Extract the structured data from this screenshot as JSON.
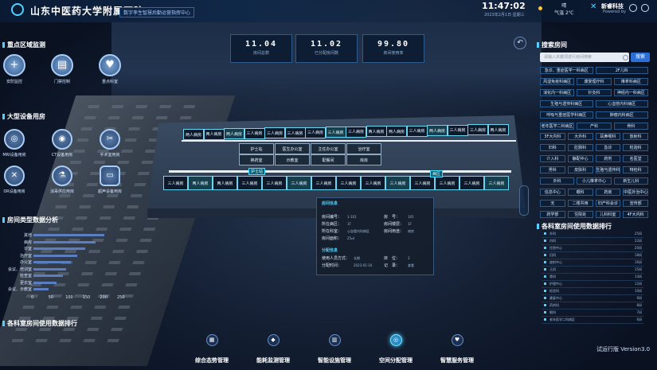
{
  "header": {
    "title": "山东中医药大学附属医院",
    "subtitle": "数字孪生智慧后勤运营指挥中心",
    "time": "11:47:02",
    "date": "2023年2月1日 星期三",
    "weather": "晴",
    "temperature": "2℃",
    "temperature_label": "气温",
    "brand": "新睿科技",
    "brand_sub": "Powered by"
  },
  "stats": [
    {
      "value": "11.04",
      "label": "房间总数"
    },
    {
      "value": "11.02",
      "label": "已分配房间数"
    },
    {
      "value": "99.80",
      "label": "房间使用率"
    }
  ],
  "left": {
    "section_key_area": "重点区域监测",
    "key_buttons": [
      {
        "label": "安防监控",
        "icon": "plus-icon"
      },
      {
        "label": "门禁控制",
        "icon": "book-icon"
      },
      {
        "label": "重点科室",
        "icon": "heart-icon"
      }
    ],
    "section_devices": "大型设备用房",
    "device_buttons": [
      {
        "label": "MRI设备用房",
        "icon": "mri-icon"
      },
      {
        "label": "CT设备用房",
        "icon": "ct-icon"
      },
      {
        "label": "手术室用房",
        "icon": "scissors-icon"
      },
      {
        "label": "DR设备用房",
        "icon": "x-icon"
      },
      {
        "label": "消毒供应用房",
        "icon": "lab-icon"
      },
      {
        "label": "超声设备用房",
        "icon": "monitor-icon"
      }
    ],
    "section_room_types": "房间类型数据分析",
    "section_usage_rank": "各科室房间使用数据排行"
  },
  "chart_data": {
    "type": "bar",
    "orientation": "horizontal",
    "categories": [
      "其他",
      "病房",
      "诊室",
      "治疗室",
      "办公室",
      "会议、培训室",
      "检查室",
      "更衣室",
      "会议、示教室"
    ],
    "values": [
      205,
      180,
      150,
      128,
      108,
      95,
      85,
      68,
      45
    ],
    "xticks": [
      "0",
      "50",
      "100",
      "150",
      "200",
      "250"
    ],
    "xlim": [
      0,
      250
    ],
    "color": "#5a7ec0"
  },
  "floorplan": {
    "rooms_row1": [
      "两人病房",
      "两人病房",
      "两人病房",
      "三人病房",
      "三人病房",
      "三人病房",
      "三人病房",
      "三人病房",
      "三人病房",
      "两人病房",
      "两人病房",
      "三人病房",
      "两人病房",
      "三人病房",
      "三人病房",
      "两人病房"
    ],
    "rooms_row2": [
      "三人病房",
      "两人病房",
      "两人病房",
      "三人病房",
      "三人病房",
      "三人病房",
      "三人病房",
      "三人病房",
      "三人病房",
      "三人病房",
      "三人病房",
      "三人病房",
      "三人病房",
      "三人病房"
    ],
    "center_rooms": [
      "护士站",
      "医生办公室",
      "主任办公室",
      "治疗室",
      "换药室",
      "示教室",
      "配餐间",
      "库房"
    ],
    "tags": [
      "护士站",
      "病区"
    ]
  },
  "popup": {
    "head1": "房间信息",
    "fields": [
      {
        "k": "房间编号：",
        "v": "1-101"
      },
      {
        "k": "所在病区：",
        "v": "1F"
      },
      {
        "k": "所在科室：",
        "v": "心血管内科病区"
      },
      {
        "k": "房间面积：",
        "v": "25㎡"
      }
    ],
    "fields_right": [
      {
        "k": "房　号：",
        "v": "101"
      },
      {
        "k": "房间楼层：",
        "v": "1F"
      },
      {
        "k": "房间用途：",
        "v": "病房"
      }
    ],
    "head2": "分配信息",
    "alloc": [
      {
        "k": "使用人员方式：",
        "v": "长期"
      },
      {
        "k": "分配时间：",
        "v": "2023-01-10"
      }
    ],
    "alloc_right": [
      {
        "k": "床　位：",
        "v": "3"
      },
      {
        "k": "记　录：",
        "v": "查看"
      }
    ]
  },
  "right": {
    "section_search": "搜索房间",
    "search_placeholder": "请输入关键词进行房间搜索",
    "search_button": "搜索",
    "chips": [
      [
        "急诊、重症医学一科病区",
        "2F儿科"
      ],
      [
        "风湿免疫科病区",
        "康复理疗科",
        "推拿科病区"
      ],
      [
        "消化内一科病区",
        "针灸科",
        "神经内一科病区"
      ],
      [
        "生殖与遗传科病区",
        "心血管内科病区"
      ],
      [
        "呼吸与重症医学科病区",
        "肿瘤内科病区"
      ],
      [
        "老年医学二科病区",
        "产科",
        "骨科"
      ],
      [
        "3F大内科",
        "大外科",
        "耳鼻喉科",
        "放射科"
      ],
      [
        "妇科",
        "肛肠科",
        "急诊",
        "检验科"
      ],
      [
        "介入科",
        "静配中心",
        "药剂",
        "名医堂"
      ],
      [
        "男科",
        "皮肤科",
        "生殖与遗传科",
        "特检科"
      ],
      [
        "外科",
        "小儿推拿中心",
        "新生儿科"
      ],
      [
        "信息中心",
        "眼科",
        "药房",
        "中医外治中心"
      ],
      [
        "无",
        "二楼共用",
        "妇产科会诊",
        "宣传部"
      ],
      [
        "药学部",
        "住院处",
        "儿科科室",
        "4F大内科"
      ]
    ],
    "section_usage": "各科室房间使用数据排行",
    "usage_rows": [
      {
        "name": "外科",
        "val": "25间"
      },
      {
        "name": "内科",
        "val": "22间"
      },
      {
        "name": "住院中心",
        "val": "20间"
      },
      {
        "name": "妇科",
        "val": "18间"
      },
      {
        "name": "放射中心",
        "val": "16间"
      },
      {
        "name": "儿科",
        "val": "15间"
      },
      {
        "name": "骨科",
        "val": "14间"
      },
      {
        "name": "护理中心",
        "val": "12间"
      },
      {
        "name": "检验科",
        "val": "10间"
      },
      {
        "name": "康复中心",
        "val": "9间"
      },
      {
        "name": "药剂科",
        "val": "8间"
      },
      {
        "name": "眼科",
        "val": "7间"
      },
      {
        "name": "老年医学二科病区",
        "val": "6间"
      }
    ]
  },
  "tabs": [
    {
      "label": "综合态势管理",
      "icon": "grid-icon",
      "active": false
    },
    {
      "label": "能耗监测管理",
      "icon": "drop-icon",
      "active": false
    },
    {
      "label": "智能设施管理",
      "icon": "device-icon",
      "active": false
    },
    {
      "label": "空间分配管理",
      "icon": "space-icon",
      "active": true
    },
    {
      "label": "智慧服务管理",
      "icon": "heart-icon",
      "active": false
    }
  ],
  "version": "试运行版 Version3.0"
}
